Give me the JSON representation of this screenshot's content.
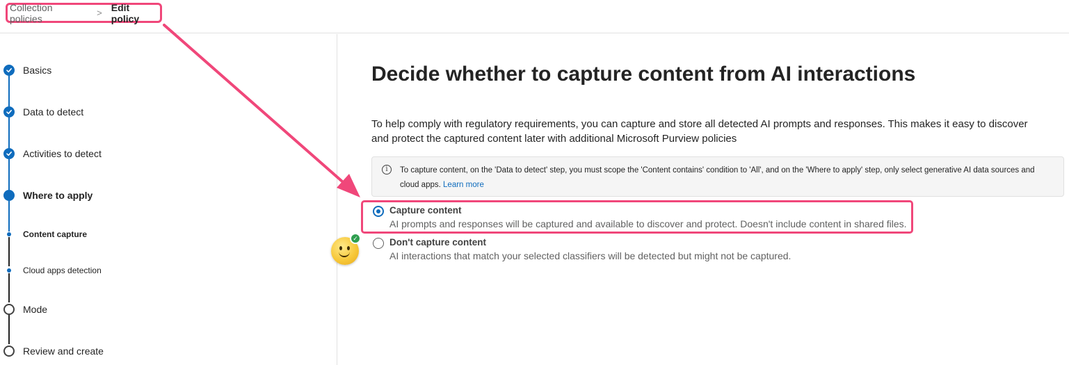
{
  "breadcrumb": {
    "parent": "Collection policies",
    "separator": ">",
    "current": "Edit policy"
  },
  "steps": [
    {
      "label": "Basics",
      "state": "completed"
    },
    {
      "label": "Data to detect",
      "state": "completed"
    },
    {
      "label": "Activities to detect",
      "state": "completed"
    },
    {
      "label": "Where to apply",
      "state": "current"
    },
    {
      "label": "Content capture",
      "state": "current-substep"
    },
    {
      "label": "Cloud apps detection",
      "state": "substep"
    },
    {
      "label": "Mode",
      "state": "not-started"
    },
    {
      "label": "Review and create",
      "state": "not-started"
    }
  ],
  "main": {
    "title": "Decide whether to capture content from AI interactions",
    "description": "To help comply with regulatory requirements, you can capture and store all detected AI prompts and responses. This makes it easy to discover and protect the captured content later with additional Microsoft Purview policies",
    "info": {
      "icon": "info-icon",
      "text": "To capture content, on the 'Data to detect' step, you must scope the 'Content contains' condition to 'All', and on the 'Where to apply' step, only select generative AI data sources and cloud apps.",
      "link": "Learn more"
    },
    "options": [
      {
        "title": "Capture content",
        "description": "AI prompts and responses will be captured and available to discover and protect. Doesn't include content in shared files.",
        "selected": true
      },
      {
        "title": "Don't capture content",
        "description": "AI interactions that match your selected classifiers will be detected but might not be captured.",
        "selected": false
      }
    ]
  },
  "colors": {
    "accent": "#0f6cbd",
    "annotation": "#f0477a",
    "success_badge": "#2e9e4f"
  }
}
